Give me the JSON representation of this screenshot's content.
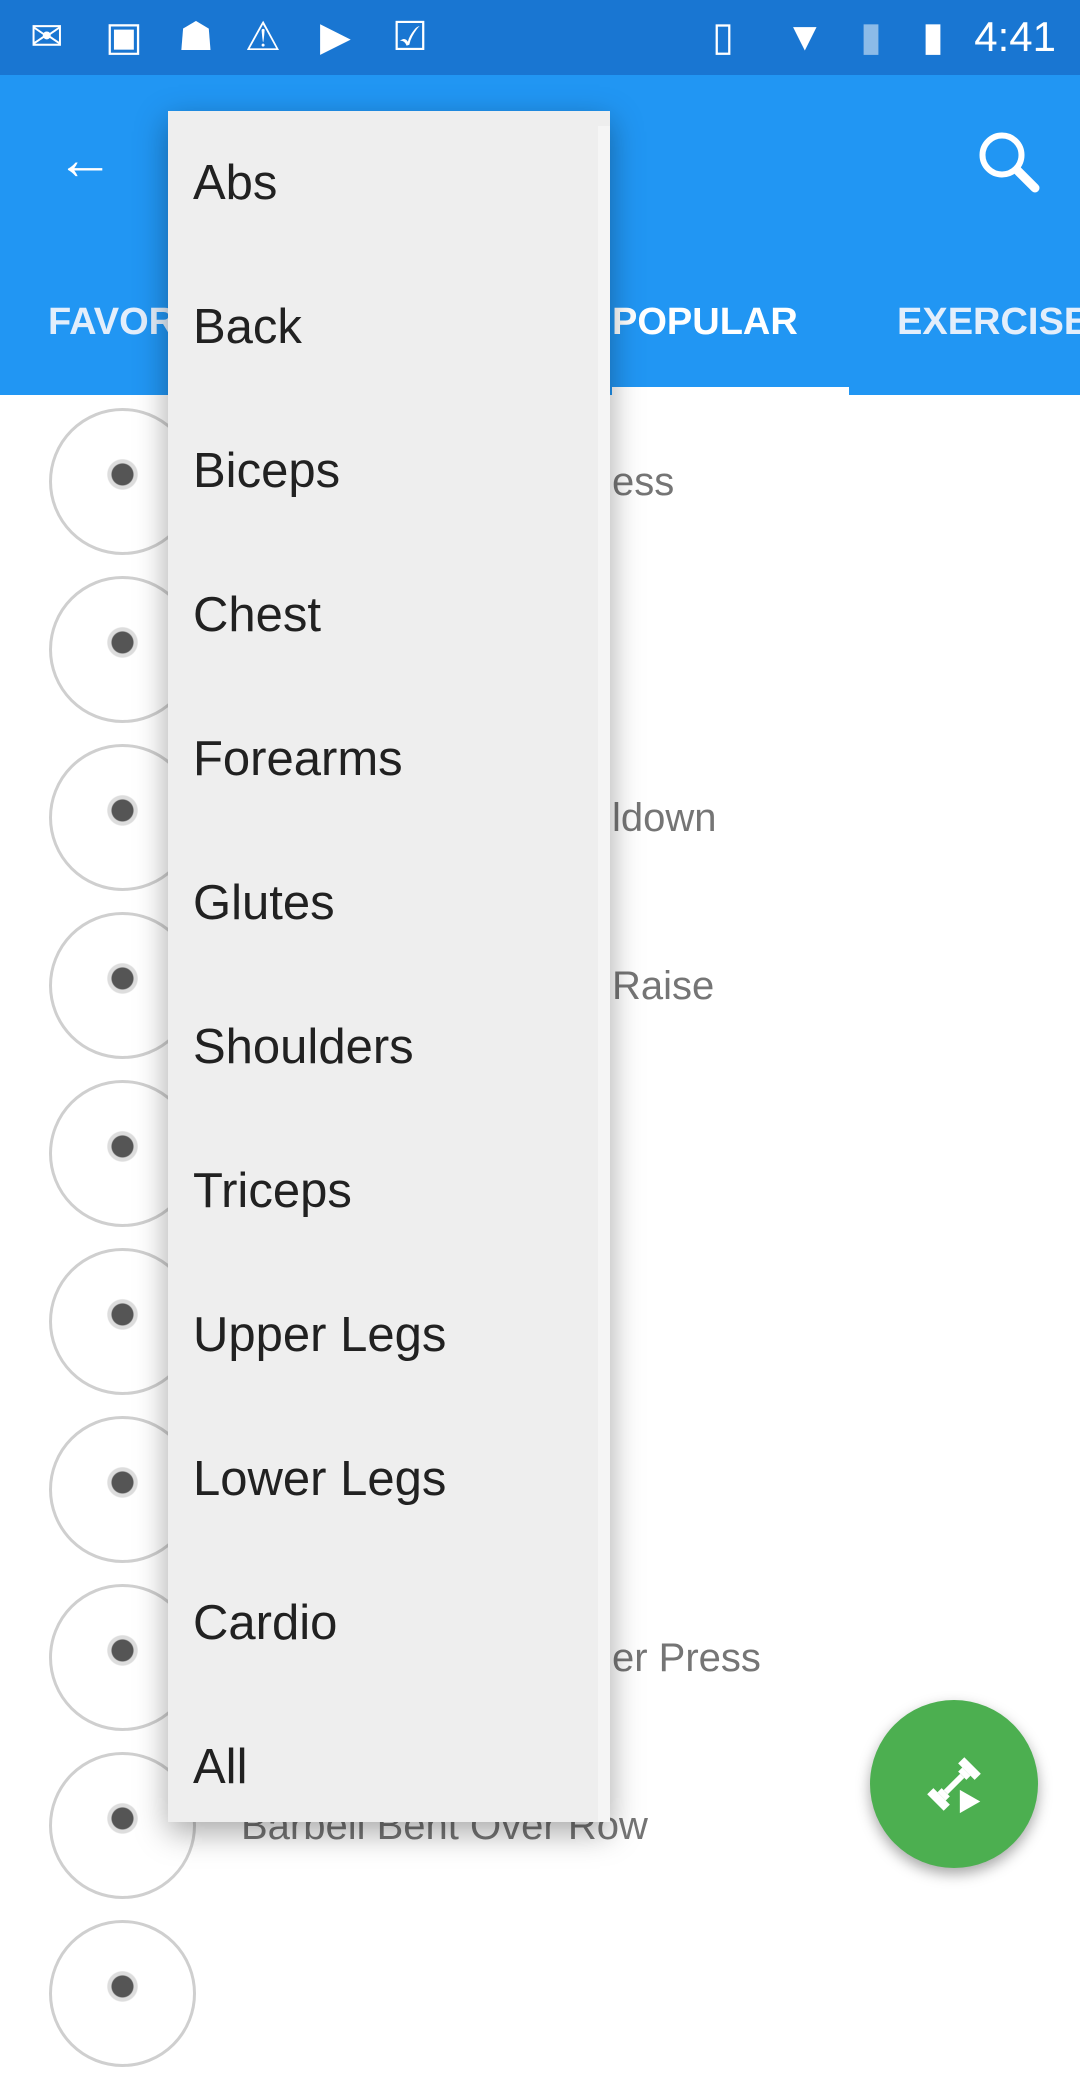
{
  "status_bar": {
    "time": "4:41",
    "icons": [
      "gmail-icon",
      "image-icon",
      "android-debug-icon",
      "warning-icon",
      "play-store-icon",
      "task-icon",
      "vibrate-icon",
      "wifi-icon",
      "no-sim-icon",
      "battery-charging-icon"
    ]
  },
  "app_bar": {
    "back_icon": "arrow-left-icon",
    "search_icon": "search-icon"
  },
  "tabs": [
    {
      "label": "FAVOR"
    },
    {
      "label": "POPULAR",
      "active": true
    },
    {
      "label": "EXERCISE"
    }
  ],
  "list": {
    "items": [
      {
        "name": "ess"
      },
      {
        "name": ""
      },
      {
        "name": "ldown"
      },
      {
        "name": "Raise"
      },
      {
        "name": ""
      },
      {
        "name": ""
      },
      {
        "name": ""
      },
      {
        "name": "er Press"
      },
      {
        "name": "Barbell Bent Over Row"
      }
    ]
  },
  "menu": {
    "items": [
      "Abs",
      "Back",
      "Biceps",
      "Chest",
      "Forearms",
      "Glutes",
      "Shoulders",
      "Triceps",
      "Upper Legs",
      "Lower Legs",
      "Cardio",
      "All"
    ]
  },
  "fab": {
    "icon": "dumbbell-play-icon",
    "color": "#4CAF50"
  },
  "colors": {
    "primary": "#2196F3",
    "primary_dark": "#1976D2"
  }
}
